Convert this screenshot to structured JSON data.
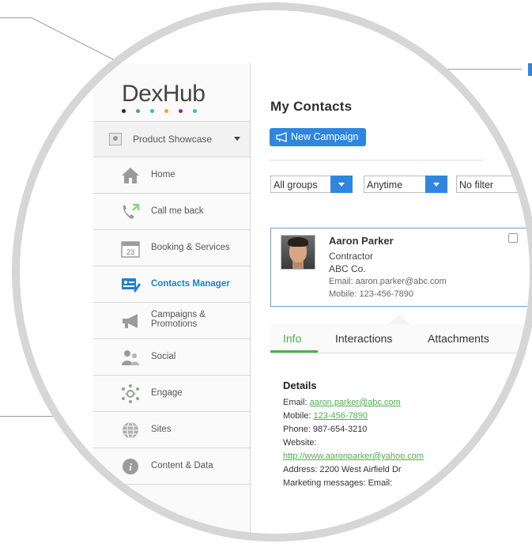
{
  "app": {
    "logo_text": "DexHub",
    "logo_dots": [
      "#1a2a5a",
      "#4db04b",
      "#3ab6e8",
      "#f4a623",
      "#a3276f",
      "#3ab6e8"
    ]
  },
  "sidebar": {
    "account": {
      "label": "Product Showcase"
    },
    "items": [
      {
        "label": "Home",
        "icon": "house-icon"
      },
      {
        "label": "Call me back",
        "icon": "phone-callback-icon"
      },
      {
        "label": "Booking & Services",
        "icon": "calendar-icon",
        "calendar_day": "23"
      },
      {
        "label": "Contacts Manager",
        "icon": "contact-card-icon",
        "active": true
      },
      {
        "label": "Campaigns & Promotions",
        "line1": "Campaigns &",
        "line2": "Promotions",
        "icon": "megaphone-icon"
      },
      {
        "label": "Social",
        "icon": "people-icon"
      },
      {
        "label": "Engage",
        "icon": "engage-network-icon"
      },
      {
        "label": "Sites",
        "icon": "globe-icon"
      },
      {
        "label": "Content & Data",
        "icon": "info-icon"
      }
    ]
  },
  "main": {
    "title": "My Contacts",
    "new_campaign_label": "New Campaign",
    "filters": {
      "group": "All groups",
      "time": "Anytime",
      "filter": "No filter"
    },
    "contact": {
      "name": "Aaron Parker",
      "role": "Contractor",
      "company": "ABC Co.",
      "email_line": "Email: aaron.parker@abc.com",
      "mobile_line": "Mobile: 123-456-7890"
    },
    "tabs": [
      {
        "label": "Info",
        "active": true
      },
      {
        "label": "Interactions"
      },
      {
        "label": "Attachments"
      }
    ],
    "details": {
      "heading": "Details",
      "email_label": "Email: ",
      "email": "aaron.parker@abc.com",
      "mobile_label": "Mobile: ",
      "mobile": "123-456-7890",
      "phone": "Phone: 987-654-3210",
      "website_label": "Website:",
      "website": "http://www.aaronparker@yahoo.com",
      "address": "Address: 2200 West Airfield Dr",
      "marketing": "Marketing messages: Email: "
    }
  },
  "colors": {
    "accent_blue": "#2e86de",
    "active_green": "#4db04b",
    "active_nav": "#1e7fd6"
  }
}
